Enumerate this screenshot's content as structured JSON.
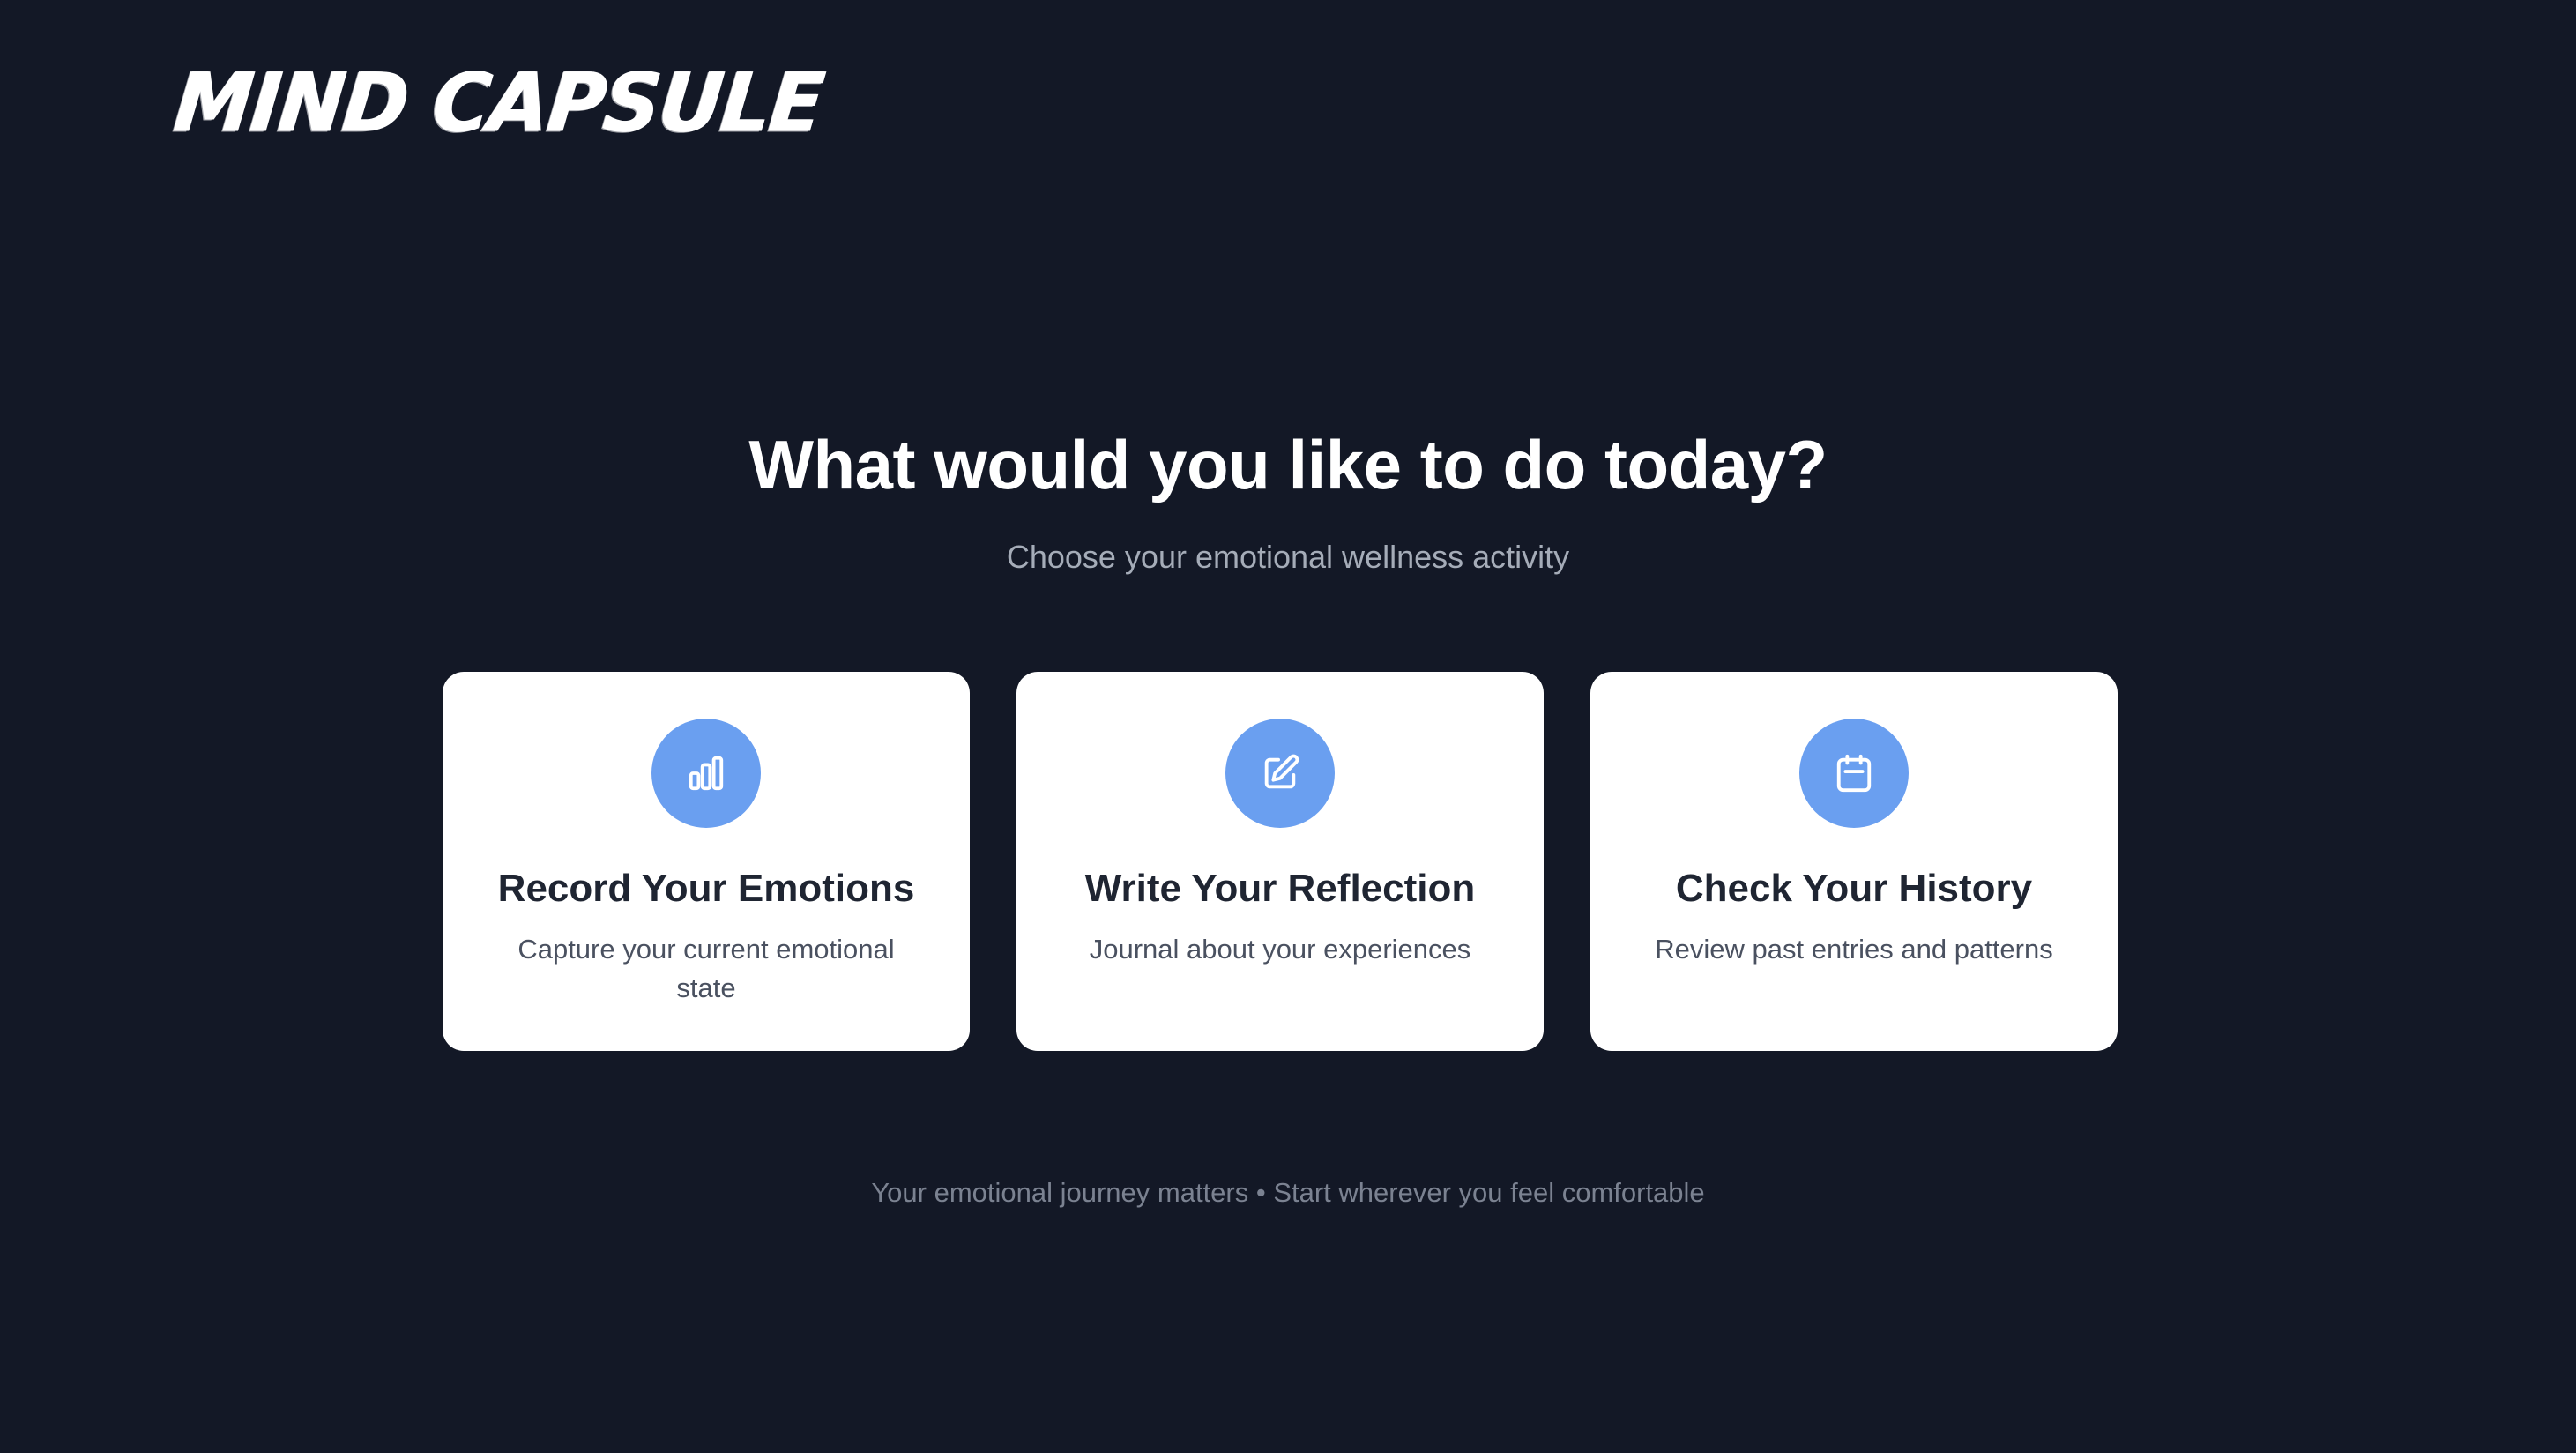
{
  "brand": {
    "logo_text": "MIND CAPSULE"
  },
  "hero": {
    "title": "What would you like to do today?",
    "subtitle": "Choose your emotional wellness activity"
  },
  "cards": [
    {
      "icon": "bar-chart-icon",
      "title": "Record Your Emotions",
      "description": "Capture your current emotional state"
    },
    {
      "icon": "edit-icon",
      "title": "Write Your Reflection",
      "description": "Journal about your experiences"
    },
    {
      "icon": "calendar-icon",
      "title": "Check Your History",
      "description": "Review past entries and patterns"
    }
  ],
  "footer": {
    "note": "Your emotional journey matters • Start wherever you feel comfortable"
  },
  "colors": {
    "background": "#131826",
    "card_background": "#ffffff",
    "accent": "#6a9ff0",
    "title_text": "#ffffff",
    "subtitle_text": "#a5acb8",
    "card_title_text": "#1f2532",
    "card_desc_text": "#4a5160",
    "footer_text": "#7b8291"
  }
}
